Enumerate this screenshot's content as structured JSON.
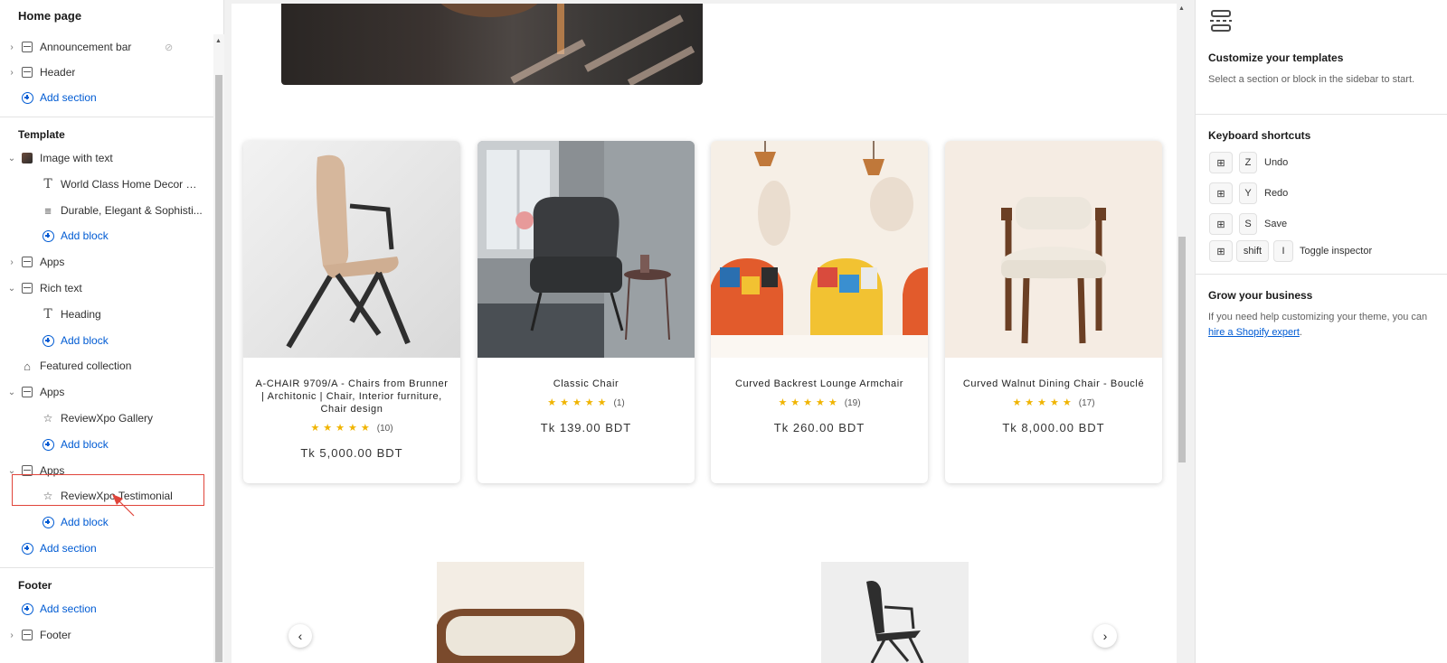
{
  "sidebar": {
    "title": "Home page",
    "header_group": {
      "items": [
        {
          "label": "Announcement bar",
          "hidden": true
        },
        {
          "label": "Header"
        }
      ],
      "add_section": "Add section"
    },
    "template_group": {
      "heading": "Template",
      "sections": [
        {
          "label": "Image with text",
          "blocks": [
            "World Class Home Decor & ...",
            "Durable, Elegant & Sophisti..."
          ],
          "add_block": "Add block"
        },
        {
          "label": "Apps"
        },
        {
          "label": "Rich text",
          "blocks": [
            "Heading"
          ],
          "add_block": "Add block"
        },
        {
          "label": "Featured collection"
        },
        {
          "label": "Apps",
          "blocks": [
            "ReviewXpo Gallery"
          ],
          "add_block": "Add block"
        },
        {
          "label": "Apps",
          "blocks": [
            "ReviewXpo Testimonial"
          ],
          "add_block": "Add block"
        }
      ],
      "add_section": "Add section"
    },
    "footer_group": {
      "heading": "Footer",
      "add_section": "Add section",
      "items": [
        {
          "label": "Footer"
        }
      ]
    }
  },
  "preview": {
    "products": [
      {
        "title": "A-CHAIR 9709/A - Chairs from Brunner | Architonic | Chair, Interior furniture, Chair design",
        "stars": "★★★★★",
        "reviews": "(10)",
        "price": "Tk 5,000.00 BDT",
        "rating": 5
      },
      {
        "title": "Classic Chair",
        "stars": "★★★★★",
        "reviews": "(1)",
        "price": "Tk 139.00 BDT",
        "rating": 5
      },
      {
        "title": "Curved Backrest Lounge Armchair",
        "stars": "★★★★★",
        "reviews": "(19)",
        "price": "Tk 260.00 BDT",
        "rating": 5
      },
      {
        "title": "Curved Walnut Dining Chair - Bouclé",
        "stars": "★★★★★",
        "reviews": "(17)",
        "price": "Tk 8,000.00 BDT",
        "rating": 5
      }
    ],
    "carousel_prev": "‹",
    "carousel_next": "›"
  },
  "inspector": {
    "customize_title": "Customize your templates",
    "customize_text": "Select a section or block in the sidebar to start.",
    "shortcuts_title": "Keyboard shortcuts",
    "shortcuts": [
      {
        "modifier": "⊞",
        "key": "Z",
        "label": "Undo"
      },
      {
        "modifier": "⊞",
        "key": "Y",
        "label": "Redo"
      },
      {
        "modifier": "⊞",
        "key": "S",
        "label": "Save"
      },
      {
        "modifier": "⊞",
        "key2": "shift",
        "key": "I",
        "label": "Toggle inspector"
      }
    ],
    "grow_title": "Grow your business",
    "grow_text_before": "If you need help customizing your theme, you can ",
    "grow_link": "hire a Shopify expert",
    "grow_text_after": "."
  },
  "colors": {
    "accent": "#005bd3",
    "highlight": "#e0443a",
    "star": "#f0b400"
  },
  "icons": [
    "section-icon",
    "eye-slash-icon",
    "plus-circle-icon",
    "text-icon",
    "paragraph-icon",
    "image-icon",
    "apps-icon",
    "tag-icon",
    "star-icon",
    "chevron-right-icon",
    "chevron-down-icon",
    "windows-key-icon"
  ]
}
